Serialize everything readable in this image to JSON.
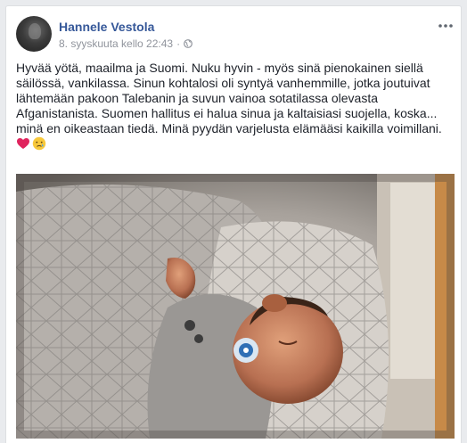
{
  "post": {
    "author": "Hannele Vestola",
    "timestamp": "8. syyskuuta kello 22:43",
    "separator": "·",
    "privacy_icon": "globe-icon",
    "more_icon": "more-options-icon",
    "text": "Hyvää yötä, maailma ja Suomi. Nuku hyvin - myös sinä pienokainen siellä säilössä, vankilassa. Sinun kohtalosi oli syntyä vanhemmille, jotka joutuivat lähtemään pakoon Talebanin ja suvun vainoa sotatilassa olevasta Afganistanista. Suomen hallitus ei halua sinua ja kaltaisiasi suojella, koska... minä en oikeastaan tiedä. Minä pyydän varjelusta elämääsi kaikilla voimillani.",
    "emojis": [
      "heart-emoji",
      "crying-face-emoji"
    ],
    "photo_icon": "photo-sleeping-baby"
  },
  "colors": {
    "author_link": "#365899",
    "meta_gray": "#90949c",
    "text": "#1d2129",
    "heart": "#e0245e"
  }
}
